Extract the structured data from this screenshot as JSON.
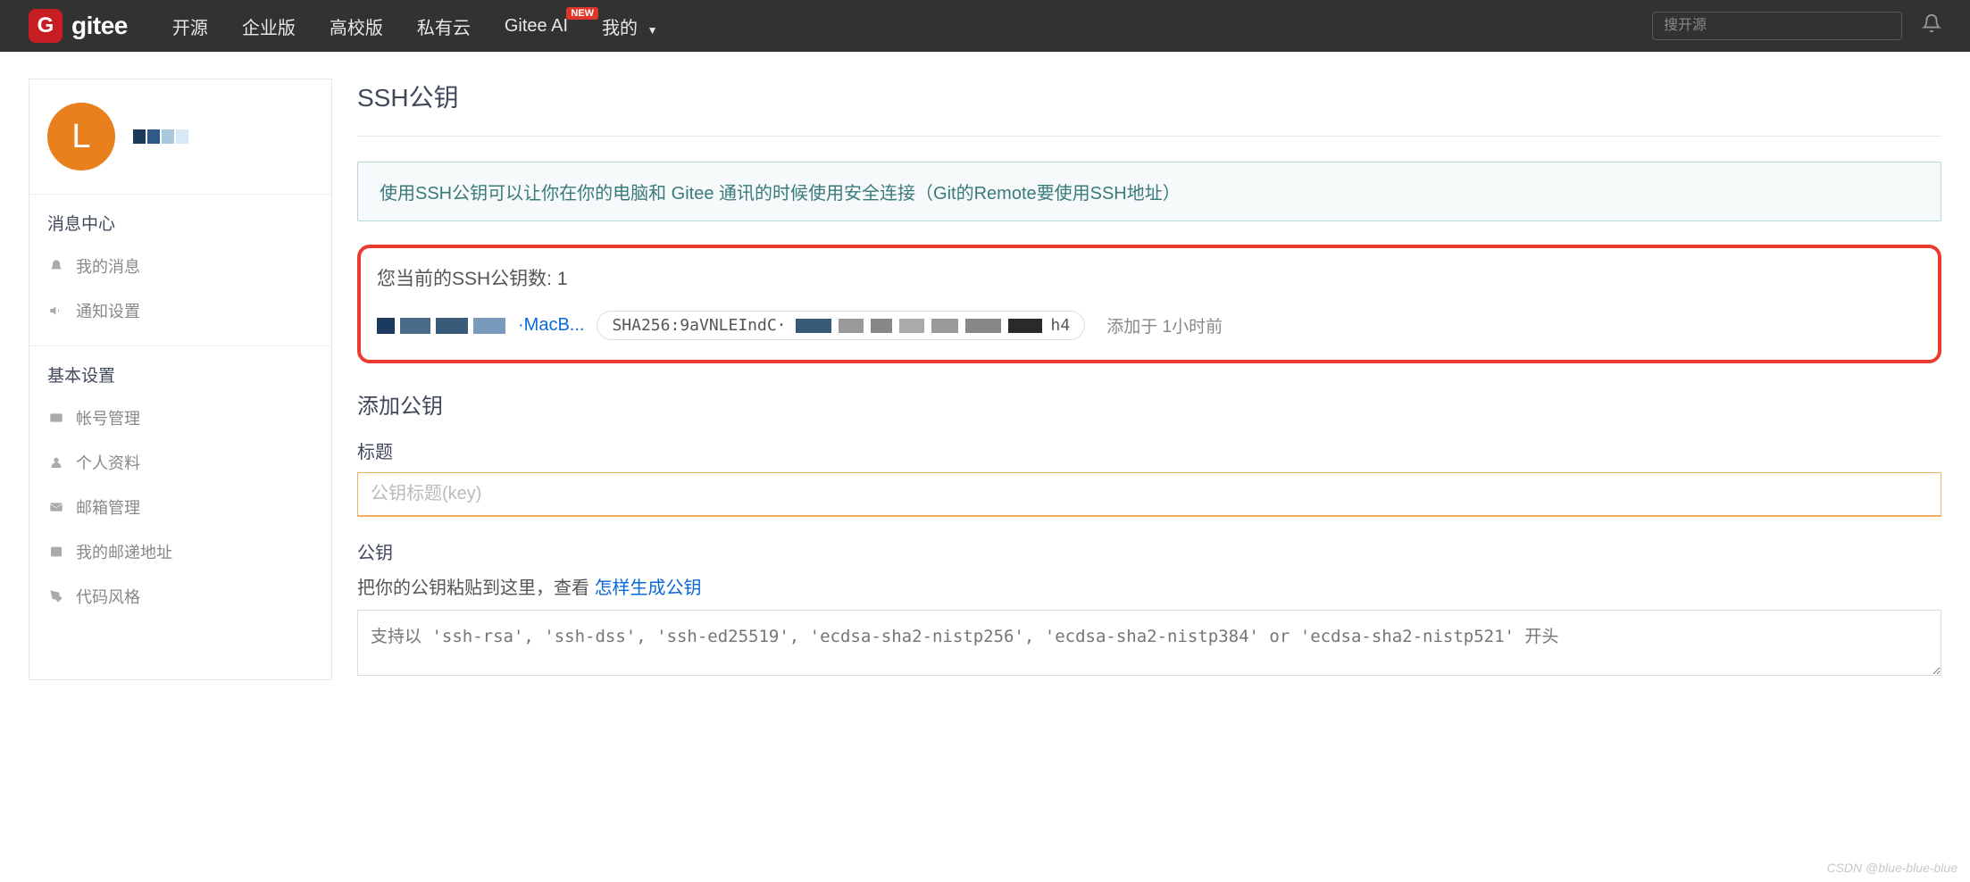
{
  "nav": {
    "logo_letter": "G",
    "logo_text": "gitee",
    "links": [
      "开源",
      "企业版",
      "高校版",
      "私有云"
    ],
    "ai_link": "Gitee AI",
    "new_badge": "NEW",
    "mine": "我的",
    "search_placeholder": "搜开源"
  },
  "sidebar": {
    "avatar_letter": "L",
    "sections": [
      {
        "heading": "消息中心",
        "items": [
          "我的消息",
          "通知设置"
        ]
      },
      {
        "heading": "基本设置",
        "items": [
          "帐号管理",
          "个人资料",
          "邮箱管理",
          "我的邮递地址",
          "代码风格"
        ]
      }
    ]
  },
  "main": {
    "title": "SSH公钥",
    "banner": "使用SSH公钥可以让你在你的电脑和 Gitee 通讯的时候使用安全连接（Git的Remote要使用SSH地址）",
    "key_count_label": "您当前的SSH公钥数:",
    "key_count": "1",
    "key_device": "·MacB...",
    "key_hash_prefix": "SHA256:9aVNLEIndC·",
    "key_hash_suffix": "h4",
    "key_time_prefix": "添加于",
    "key_time": "1小时前",
    "add_title": "添加公钥",
    "field_title": "标题",
    "title_placeholder": "公钥标题(key)",
    "field_key": "公钥",
    "paste_prefix": "把你的公钥粘贴到这里，查看",
    "paste_link": "怎样生成公钥",
    "textarea_placeholder": "支持以 'ssh-rsa', 'ssh-dss', 'ssh-ed25519', 'ecdsa-sha2-nistp256', 'ecdsa-sha2-nistp384' or 'ecdsa-sha2-nistp521' 开头"
  },
  "watermark": "CSDN @blue-blue-blue"
}
